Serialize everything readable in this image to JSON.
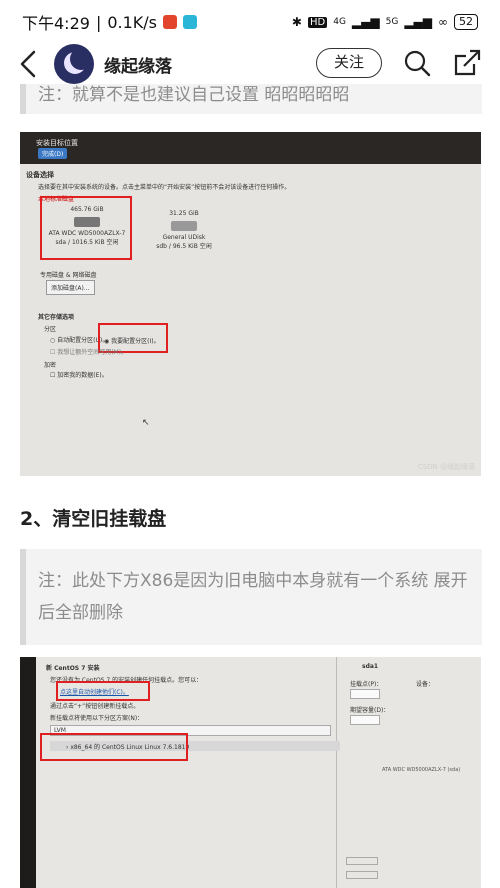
{
  "status_bar": {
    "time": "下午4:29",
    "speed": "0.1K/s",
    "network_1": "4G",
    "network_2": "5G",
    "battery": "52"
  },
  "header": {
    "author": "缘起缘落",
    "follow_label": "关注"
  },
  "article": {
    "note_top": "注：就算不是也建议自己设置 昭昭昭昭昭",
    "section_heading": "2、清空旧挂载盘",
    "note_mid": "注：此处下方X86是因为旧电脑中本身就有一个系统  展开后全部删除"
  },
  "screenshot1": {
    "window_title": "安装目标位置",
    "done_button": "完成(D)",
    "section_title": "设备选择",
    "instructions": "选择要在其中安装系统的设备。点击主菜单中的“开始安装”按钮前不会对该设备进行任何操作。",
    "local_disks_label": "本地标准磁盘",
    "disk1_size": "465.76 GiB",
    "disk1_name": "ATA WDC WD5000AZLX-7",
    "disk1_info": "sda  /  1016.5 KiB 空闲",
    "disk2_size": "31.25 GiB",
    "disk2_name": "General UDisk",
    "disk2_info": "sdb  /  96.5 KiB 空闲",
    "special_disks_label": "专用磁盘 & 网络磁盘",
    "add_disk_button": "添加磁盘(A)...",
    "other_options_label": "其它存储选项",
    "partition_label": "分区",
    "auto_partition": "自动配置分区(U)。",
    "manual_partition": "我要配置分区(I)。",
    "extra_space": "我想让额外空间可用(M)。",
    "encryption_label": "加密",
    "encrypt_data": "加密我的数据(E)。",
    "watermark": "CSDN @缘起缘落"
  },
  "screenshot2": {
    "window_title": "新 CentOS 7 安装",
    "sidebar_text_1": "您还没有为 CentOS 7 的安装创建任何挂载点。您可以：",
    "auto_create_link": "点这里自动创建他们(C)。",
    "sidebar_text_2": "通过点击“+”按钮创建新挂载点。",
    "sidebar_text_3": "新挂载点将使用以下分区方案(N)：",
    "scheme": "LVM",
    "existing_system": "x86_64 的 CentOS Linux Linux 7.6.1810",
    "right_title": "sda1",
    "mount_point_label": "挂载点(P)：",
    "device_label": "设备：",
    "desired_capacity_label": "期望容量(D)：",
    "device_model": "ATA WDC WD5000AZLX-7 (sda)"
  }
}
